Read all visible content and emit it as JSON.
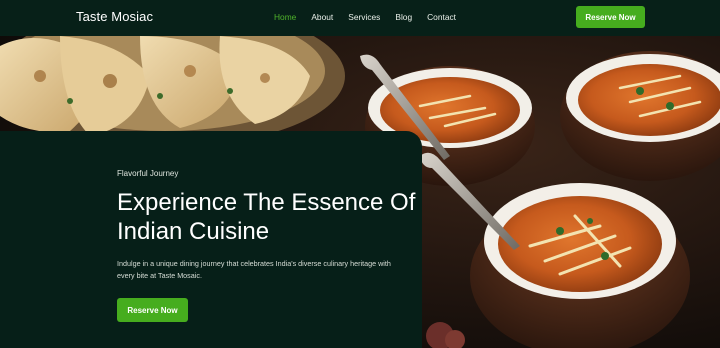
{
  "brand": {
    "name": "Taste Mosiac"
  },
  "nav": {
    "links": [
      {
        "label": "Home",
        "active": true
      },
      {
        "label": "About"
      },
      {
        "label": "Services"
      },
      {
        "label": "Blog"
      },
      {
        "label": "Contact"
      }
    ],
    "cta_label": "Reserve Now"
  },
  "hero": {
    "eyebrow": "Flavorful Journey",
    "title": "Experience The Essence Of Indian Cuisine",
    "description": "Indulge in a unique dining journey that celebrates India's diverse culinary heritage with every bite at Taste Mosaic.",
    "cta_label": "Reserve Now",
    "image_icon": "food-photo"
  },
  "colors": {
    "accent": "#46ad1e",
    "active_link": "#4fb32b",
    "background": "#061612",
    "card": "#061f18"
  }
}
